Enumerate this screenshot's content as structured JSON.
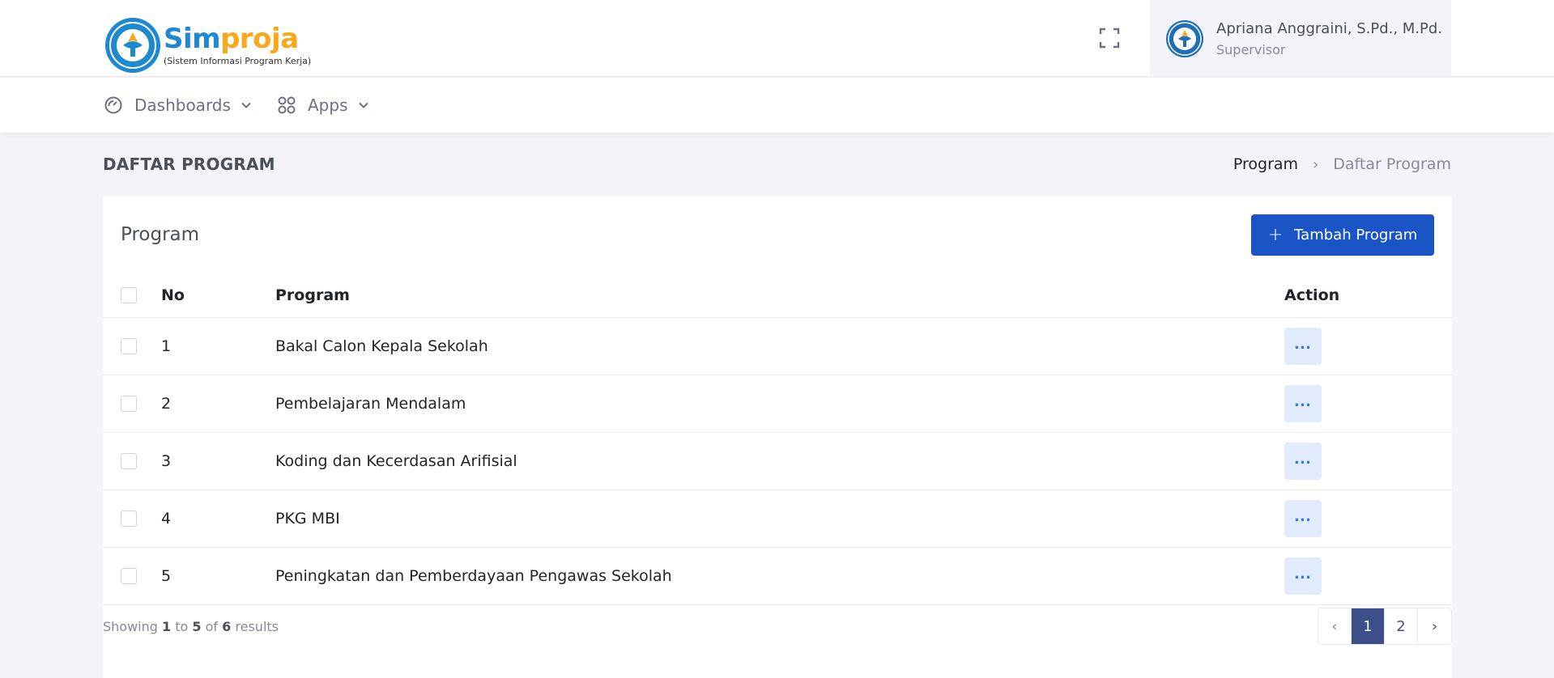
{
  "app": {
    "logo_sim": "Sim",
    "logo_proja": "proja",
    "logo_sub": "(Sistem Informasi Program Kerja)"
  },
  "user": {
    "name": "Apriana Anggraini, S.Pd., M.Pd.",
    "role": "Supervisor"
  },
  "nav": {
    "dashboards": "Dashboards",
    "apps": "Apps"
  },
  "page": {
    "title": "DAFTAR PROGRAM",
    "breadcrumb": [
      "Program",
      "Daftar Program"
    ]
  },
  "card": {
    "title": "Program",
    "add_button": "Tambah Program"
  },
  "table": {
    "headers": {
      "no": "No",
      "program": "Program",
      "action": "Action"
    },
    "rows": [
      {
        "no": "1",
        "program": "Bakal Calon Kepala Sekolah"
      },
      {
        "no": "2",
        "program": "Pembelajaran Mendalam"
      },
      {
        "no": "3",
        "program": "Koding dan Kecerdasan Arifisial"
      },
      {
        "no": "4",
        "program": "PKG MBI"
      },
      {
        "no": "5",
        "program": "Peningkatan dan Pemberdayaan Pengawas Sekolah"
      }
    ]
  },
  "footer": {
    "showing": "Showing",
    "from": "1",
    "to_word": "to",
    "to": "5",
    "of_word": "of",
    "total": "6",
    "results": "results"
  },
  "pagination": {
    "prev": "‹",
    "pages": [
      "1",
      "2"
    ],
    "next": "›"
  },
  "colors": {
    "primary": "#1a55c6",
    "brand_blue": "#1e88d0",
    "brand_orange": "#f7a81b",
    "active_page": "#3d4f8a"
  }
}
